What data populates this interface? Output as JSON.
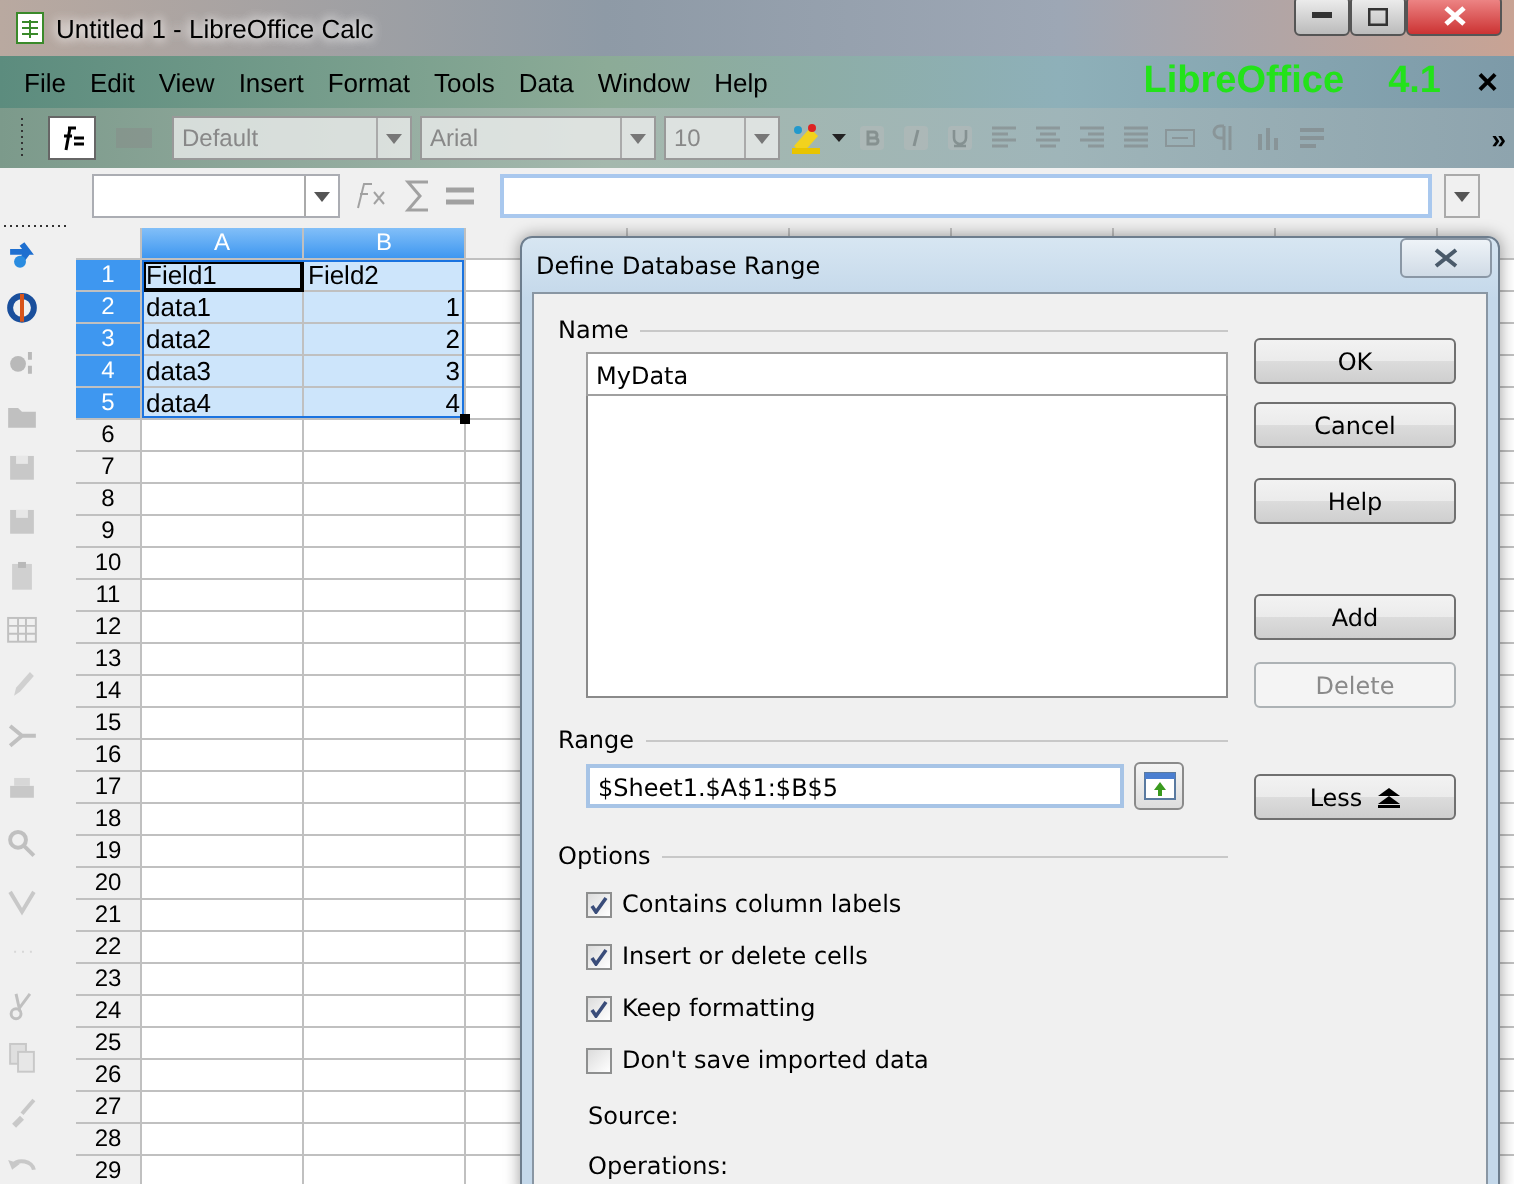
{
  "window": {
    "title": "Untitled 1 - LibreOffice Calc",
    "brand": "LibreOffice",
    "version": "4.1",
    "menu_close": "×"
  },
  "menu": [
    {
      "label": "File"
    },
    {
      "label": "Edit"
    },
    {
      "label": "View"
    },
    {
      "label": "Insert"
    },
    {
      "label": "Format"
    },
    {
      "label": "Tools"
    },
    {
      "label": "Data"
    },
    {
      "label": "Window"
    },
    {
      "label": "Help"
    }
  ],
  "toolbar": {
    "style_box": {
      "value": "Default",
      "disabled": true
    },
    "font_box": {
      "value": "Arial",
      "disabled": true
    },
    "size_box": {
      "value": "10",
      "disabled": true
    },
    "more": "»",
    "tools": [
      {
        "kind": "color",
        "disabled": false
      },
      {
        "kind": "bold",
        "disabled": true
      },
      {
        "kind": "italic",
        "disabled": true
      },
      {
        "kind": "underline",
        "disabled": true
      },
      {
        "kind": "align-left",
        "disabled": true
      },
      {
        "kind": "align-center",
        "disabled": true
      },
      {
        "kind": "align-right",
        "disabled": true
      },
      {
        "kind": "justify",
        "disabled": true
      },
      {
        "kind": "merge",
        "disabled": true
      },
      {
        "kind": "pilcrow",
        "disabled": true
      },
      {
        "kind": "bars",
        "disabled": true
      },
      {
        "kind": "lines",
        "disabled": true
      }
    ]
  },
  "sidebar_tools": [
    {
      "kind": "navigator",
      "disabled": false
    },
    {
      "kind": "anchor",
      "disabled": false
    },
    {
      "kind": "shapes",
      "disabled": true
    },
    {
      "kind": "folder",
      "disabled": true
    },
    {
      "kind": "floppy",
      "disabled": true
    },
    {
      "kind": "floppy",
      "disabled": true
    },
    {
      "kind": "clipboard",
      "disabled": true
    },
    {
      "kind": "table",
      "disabled": true
    },
    {
      "kind": "pencil",
      "disabled": true
    },
    {
      "kind": "pdf",
      "disabled": true
    },
    {
      "kind": "printer",
      "disabled": true
    },
    {
      "kind": "magnifier",
      "disabled": true
    },
    {
      "kind": "spellcheck",
      "disabled": true
    },
    {
      "kind": "dots",
      "disabled": true
    },
    {
      "kind": "scissors",
      "disabled": true
    },
    {
      "kind": "pages",
      "disabled": true
    },
    {
      "kind": "brush",
      "disabled": true
    },
    {
      "kind": "undo",
      "disabled": true
    }
  ],
  "sheet": {
    "columns": [
      {
        "label": "A",
        "selected": true
      },
      {
        "label": "B",
        "selected": true
      }
    ],
    "rows": [
      {
        "label": "1",
        "selected": true,
        "cells": [
          {
            "text": "Field1",
            "kind": "text",
            "active": true
          },
          {
            "text": "Field2",
            "kind": "text",
            "active": false
          }
        ]
      },
      {
        "label": "2",
        "selected": true,
        "cells": [
          {
            "text": "data1",
            "kind": "text",
            "active": false
          },
          {
            "text": "1",
            "kind": "number",
            "active": false
          }
        ]
      },
      {
        "label": "3",
        "selected": true,
        "cells": [
          {
            "text": "data2",
            "kind": "text",
            "active": false
          },
          {
            "text": "2",
            "kind": "number",
            "active": false
          }
        ]
      },
      {
        "label": "4",
        "selected": true,
        "cells": [
          {
            "text": "data3",
            "kind": "text",
            "active": false
          },
          {
            "text": "3",
            "kind": "number",
            "active": false
          }
        ]
      },
      {
        "label": "5",
        "selected": true,
        "cells": [
          {
            "text": "data4",
            "kind": "text",
            "active": false
          },
          {
            "text": "4",
            "kind": "number",
            "active": false
          }
        ]
      },
      {
        "label": "6",
        "selected": false
      },
      {
        "label": "7",
        "selected": false
      },
      {
        "label": "8",
        "selected": false
      },
      {
        "label": "9",
        "selected": false
      },
      {
        "label": "10",
        "selected": false
      },
      {
        "label": "11",
        "selected": false
      },
      {
        "label": "12",
        "selected": false
      },
      {
        "label": "13",
        "selected": false
      },
      {
        "label": "14",
        "selected": false
      },
      {
        "label": "15",
        "selected": false
      },
      {
        "label": "16",
        "selected": false
      },
      {
        "label": "17",
        "selected": false
      },
      {
        "label": "18",
        "selected": false
      },
      {
        "label": "19",
        "selected": false
      },
      {
        "label": "20",
        "selected": false
      },
      {
        "label": "21",
        "selected": false
      },
      {
        "label": "22",
        "selected": false
      },
      {
        "label": "23",
        "selected": false
      },
      {
        "label": "24",
        "selected": false
      },
      {
        "label": "25",
        "selected": false
      },
      {
        "label": "26",
        "selected": false
      },
      {
        "label": "27",
        "selected": false
      },
      {
        "label": "28",
        "selected": false
      },
      {
        "label": "29",
        "selected": false
      }
    ]
  },
  "dialog": {
    "title": "Define Database Range",
    "name_label": "Name",
    "name_value": "MyData",
    "range_label": "Range",
    "range_value": "$Sheet1.$A$1:$B$5",
    "options_label": "Options",
    "buttons": [
      {
        "label": "OK",
        "disabled": false
      },
      {
        "label": "Cancel",
        "disabled": false
      },
      {
        "label": "Help",
        "disabled": false
      },
      {
        "label": "Add",
        "disabled": false
      },
      {
        "label": "Delete",
        "disabled": true
      }
    ],
    "less_button": "Less",
    "options": [
      {
        "label": "Contains column labels",
        "checked": true
      },
      {
        "label": "Insert or delete cells",
        "checked": true
      },
      {
        "label": "Keep formatting",
        "checked": true
      },
      {
        "label": "Don't save imported data",
        "checked": false
      }
    ],
    "source_label": "Source:",
    "operations_label": "Operations:"
  }
}
